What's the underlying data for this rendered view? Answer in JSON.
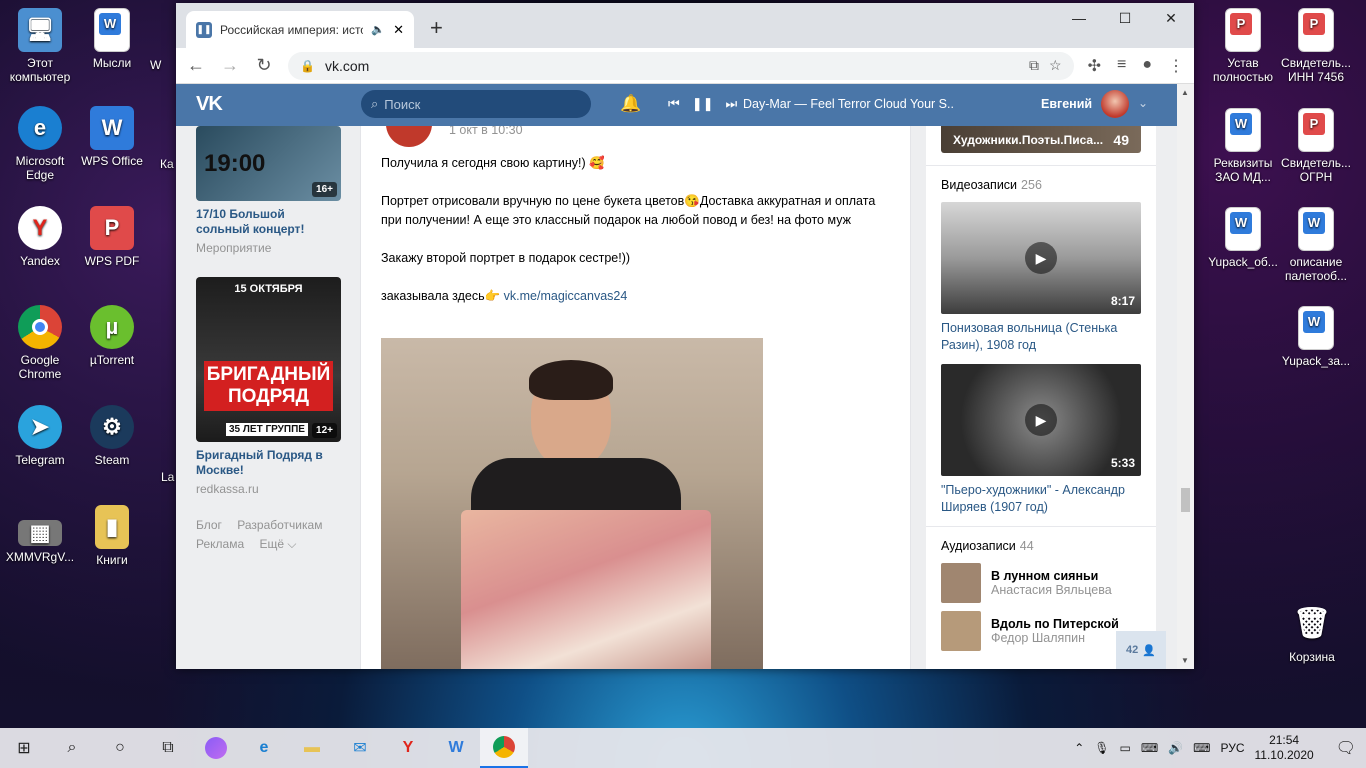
{
  "desktop_left": [
    {
      "label": "Этот компьютер",
      "icon": "computer-icon",
      "color": "#7fb2e0"
    },
    {
      "label": "Microsoft Edge",
      "icon": "edge-icon",
      "color": "#1a7fd1"
    },
    {
      "label": "Yandex",
      "icon": "yandex-icon",
      "color": "#e0241b"
    },
    {
      "label": "Google Chrome",
      "icon": "chrome-icon",
      "color": "#2a9d4a"
    },
    {
      "label": "Telegram",
      "icon": "telegram-icon",
      "color": "#2aa3dd"
    },
    {
      "label": "XMMVRgV...",
      "icon": "image-file-icon",
      "color": "#555"
    }
  ],
  "desktop_col2": [
    {
      "label": "Мысли",
      "icon": "wps-doc-icon",
      "color": "#2f7bdb"
    },
    {
      "label": "WPS Office",
      "icon": "wps-office-icon",
      "color": "#2f7bdb"
    },
    {
      "label": "WPS PDF",
      "icon": "wps-pdf-icon",
      "color": "#e04a4a"
    },
    {
      "label": "µTorrent",
      "icon": "utorrent-icon",
      "color": "#6abf2e"
    },
    {
      "label": "Steam",
      "icon": "steam-icon",
      "color": "#1b3a5c"
    },
    {
      "label": "Книги",
      "icon": "folder-icon",
      "color": "#e7c356"
    }
  ],
  "desktop_partial": [
    "W",
    "Ка",
    "",
    "",
    "La",
    ""
  ],
  "desktop_right": [
    {
      "label": "Устав полностью",
      "icon": "pdf-doc-icon",
      "color": "#e04a4a",
      "letter": "P"
    },
    {
      "label": "Свидетель... ИНН 7456",
      "icon": "pdf-doc-icon",
      "color": "#e04a4a",
      "letter": "P"
    },
    {
      "label": "Реквизиты ЗАО МД...",
      "icon": "word-doc-icon",
      "color": "#2f7bdb",
      "letter": "W"
    },
    {
      "label": "Свидетель... ОГРН",
      "icon": "pdf-doc-icon",
      "color": "#e04a4a",
      "letter": "P"
    },
    {
      "label": "Yupack_об...",
      "icon": "word-doc-icon",
      "color": "#2f7bdb",
      "letter": "W"
    },
    {
      "label": "описание палетооб...",
      "icon": "word-doc-icon",
      "color": "#2f7bdb",
      "letter": "W"
    },
    {
      "label": "Yupack_за...",
      "icon": "word-doc-icon",
      "color": "#2f7bdb",
      "letter": "W"
    }
  ],
  "recycle_bin": "Корзина",
  "browser": {
    "tab_title": "Российская империя: истор",
    "url": "vk.com"
  },
  "vk": {
    "logo": "VK",
    "search_placeholder": "Поиск",
    "track": "Day-Mar — Feel Terror Cloud Your S...",
    "user": "Евгений"
  },
  "ads": [
    {
      "image_time": "19:00",
      "age": "16+",
      "title": "17/10 Большой сольный концерт!",
      "sub": "Мероприятие"
    },
    {
      "date": "15 ОКТЯБРЯ",
      "band_line1": "БРИГАДНЫЙ",
      "band_line2": "ПОДРЯД",
      "years": "35 ЛЕТ ГРУППЕ",
      "age": "12+",
      "title": "Бригадный Подряд в Москве!",
      "sub": "redkassa.ru"
    }
  ],
  "footer_links": [
    "Блог",
    "Разработчикам",
    "Реклама",
    "Ещё ⌵"
  ],
  "post": {
    "time": "1 окт в 10:30",
    "p1": "Получила я сегодня свою картину!) 🥰",
    "p2": "Портрет отрисовали вручную по цене букета цветов😘Доставка аккуратная и оплата при получении! А еще это классный подарок на любой повод и без! на фото муж",
    "p3": "Закажу второй портрет в подарок сестре!))",
    "p4": "заказывала здесь👉",
    "link": "vk.me/magiccanvas24"
  },
  "right": {
    "group_title": "Художники.Поэты.Писа...",
    "group_count": "49",
    "videos_label": "Видеозаписи",
    "videos_count": "256",
    "videos": [
      {
        "title": "Понизовая вольница (Стенька Разин), 1908 год",
        "duration": "8:17"
      },
      {
        "title": "\"Пьеро-художники\" - Александр Ширяев (1907 год)",
        "duration": "5:33"
      }
    ],
    "audio_label": "Аудиозаписи",
    "audio_count": "44",
    "audios": [
      {
        "title": "В лунном сияньи",
        "artist": "Анастасия Вяльцева"
      },
      {
        "title": "Вдоль по Питерской",
        "artist": "Федор Шаляпин"
      }
    ],
    "online_count": "42"
  },
  "taskbar": {
    "lang": "РУС",
    "time": "21:54",
    "date": "11.10.2020"
  }
}
